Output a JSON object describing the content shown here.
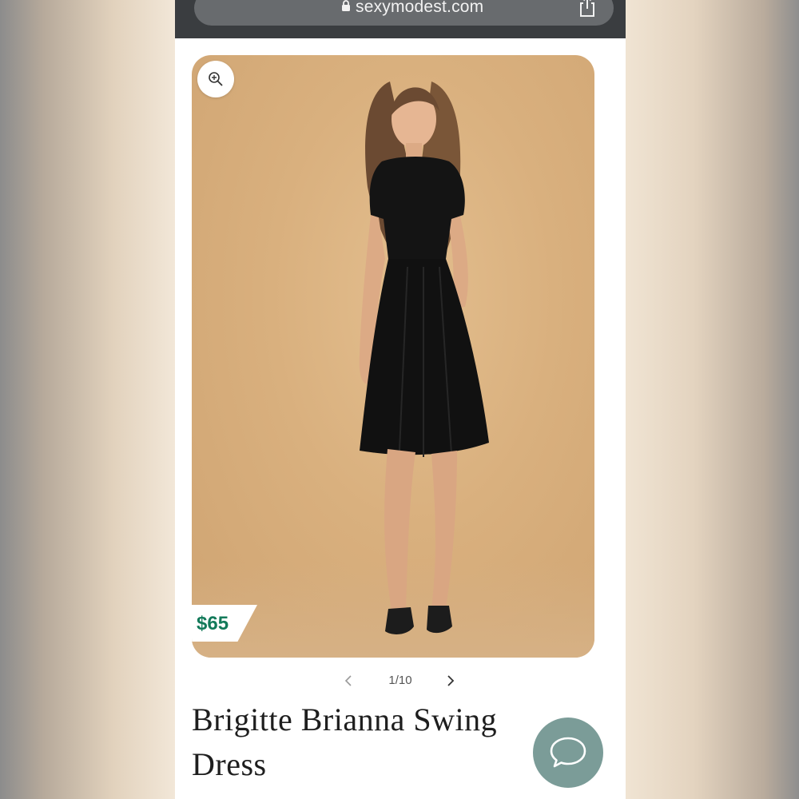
{
  "browser": {
    "url": "sexymodest.com"
  },
  "product": {
    "price": "$65",
    "title": "Brigitte Brianna Swing Dress",
    "image_alt": "Model wearing black swing dress"
  },
  "gallery": {
    "counter": "1/10"
  },
  "icons": {
    "lock": "lock-icon",
    "share": "share-icon",
    "zoom": "zoom-in-icon",
    "prev": "chevron-left-icon",
    "next": "chevron-right-icon",
    "chat": "chat-bubble-icon"
  },
  "colors": {
    "price_green": "#137a5a",
    "chat_button": "#7b9c98",
    "photo_background": "#d9b07e",
    "url_bar": "#686b6e"
  }
}
